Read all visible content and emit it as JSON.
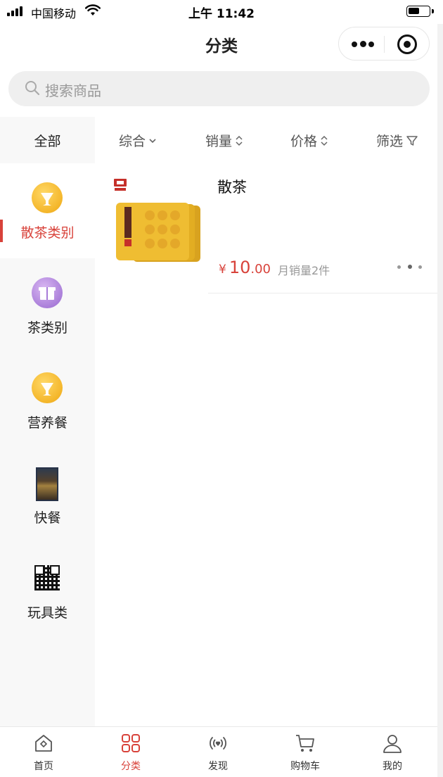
{
  "status_bar": {
    "carrier": "中国移动",
    "time": "上午 11:42",
    "battery_level": 0.55
  },
  "nav": {
    "title": "分类"
  },
  "search": {
    "placeholder": "搜索商品"
  },
  "sidebar": {
    "all_label": "全部",
    "items": [
      {
        "label": "散茶类别",
        "icon": "golden-cup-icon",
        "active": true
      },
      {
        "label": "茶类别",
        "icon": "gift-icon",
        "active": false
      },
      {
        "label": "营养餐",
        "icon": "golden-cup-icon",
        "active": false
      },
      {
        "label": "快餐",
        "icon": "restaurant-photo-icon",
        "active": false
      },
      {
        "label": "玩具类",
        "icon": "qr-code-icon",
        "active": false
      }
    ]
  },
  "sort_bar": {
    "items": [
      {
        "label": "综合",
        "icon": "chevron-down-icon"
      },
      {
        "label": "销量",
        "icon": "sort-updown-icon"
      },
      {
        "label": "价格",
        "icon": "sort-updown-icon"
      },
      {
        "label": "筛选",
        "icon": "filter-icon"
      }
    ]
  },
  "products": [
    {
      "name": "散茶",
      "currency": "¥",
      "price_int": "10",
      "price_dec": ".00",
      "sales": "月销量2件"
    }
  ],
  "tab_bar": {
    "items": [
      {
        "label": "首页",
        "icon": "home-icon",
        "active": false
      },
      {
        "label": "分类",
        "icon": "category-grid-icon",
        "active": true
      },
      {
        "label": "发现",
        "icon": "discover-icon",
        "active": false
      },
      {
        "label": "购物车",
        "icon": "cart-icon",
        "active": false
      },
      {
        "label": "我的",
        "icon": "user-icon",
        "active": false
      }
    ]
  },
  "colors": {
    "accent": "#d8423a",
    "sidebar_bg": "#f8f8f8",
    "search_bg": "#efefef",
    "text_muted": "#999999"
  }
}
